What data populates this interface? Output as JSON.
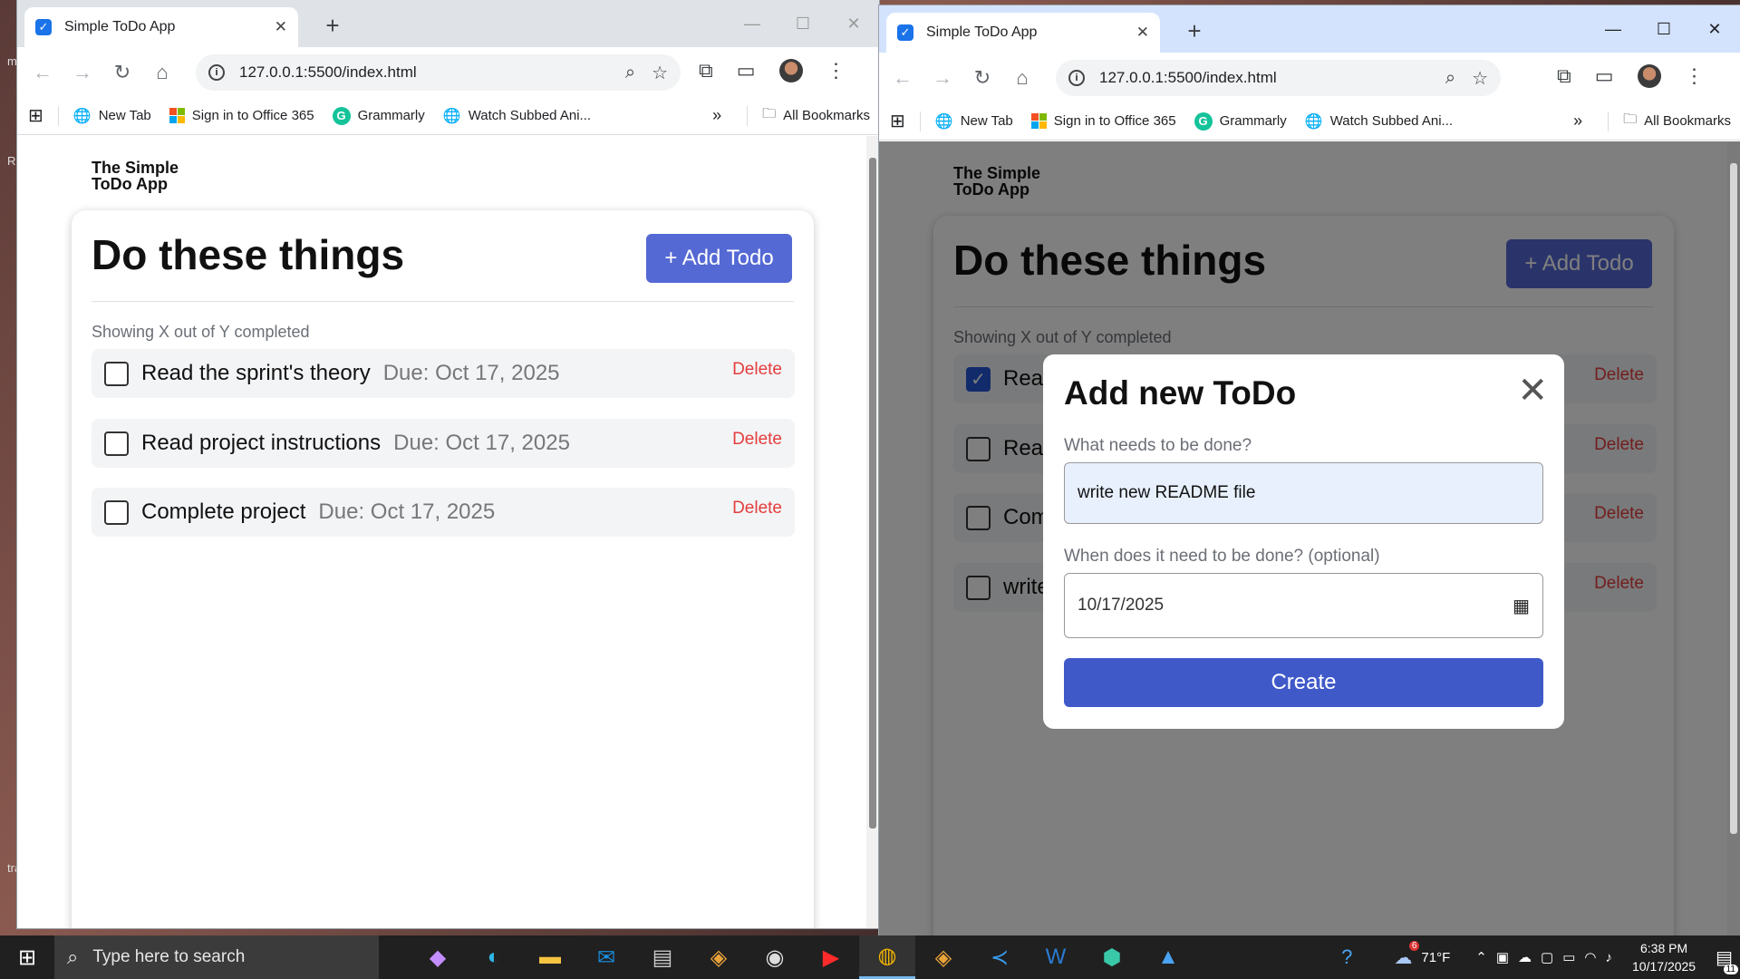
{
  "browser": {
    "tab_title": "Simple ToDo App",
    "url": "127.0.0.1:5500/index.html",
    "bookmarks": [
      "New Tab",
      "Sign in to Office 365",
      "Grammarly",
      "Watch Subbed Ani..."
    ],
    "all_bookmarks": "All Bookmarks"
  },
  "app": {
    "brand_line1": "The Simple",
    "brand_line2": "ToDo App",
    "heading": "Do these things",
    "add_label": "+ Add Todo",
    "summary": "Showing X out of Y completed",
    "delete_label": "Delete"
  },
  "left_todos": [
    {
      "text": "Read the sprint's theory",
      "due": "Due: Oct 17, 2025",
      "done": false
    },
    {
      "text": "Read project instructions",
      "due": "Due: Oct 17, 2025",
      "done": false
    },
    {
      "text": "Complete project",
      "due": "Due: Oct 17, 2025",
      "done": false
    }
  ],
  "right_todos": [
    {
      "text": "Read",
      "done": true
    },
    {
      "text": "Read",
      "done": false
    },
    {
      "text": "Com",
      "done": false
    },
    {
      "text": "write",
      "done": false
    }
  ],
  "modal": {
    "title": "Add new ToDo",
    "q1": "What needs to be done?",
    "q1_value": "write new README file",
    "q2": "When does it need to be done? (optional)",
    "q2_value": "10/17/2025",
    "create_label": "Create"
  },
  "taskbar": {
    "search_placeholder": "Type here to search",
    "weather": "71°F",
    "time": "6:38 PM",
    "date": "10/17/2025",
    "weather_badge": "6",
    "notif_count": "11"
  },
  "colors": {
    "accent": "#5469d4",
    "create": "#4059c9",
    "delete": "#e43d3d",
    "checked": "#2456d6"
  }
}
